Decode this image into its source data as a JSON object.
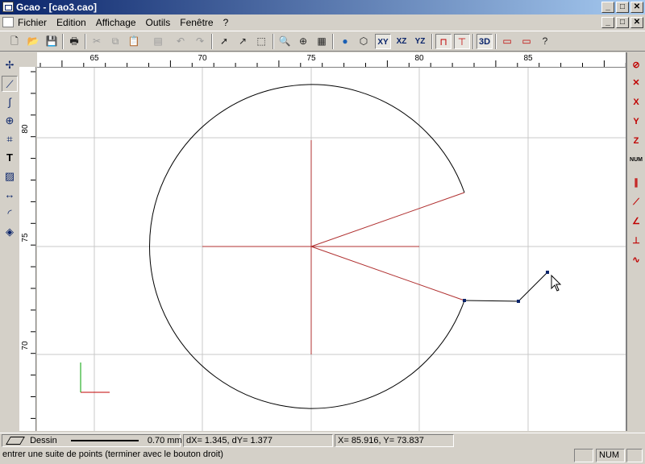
{
  "window": {
    "title": "Gcao - [cao3.cao]"
  },
  "menu": {
    "items": [
      "Fichier",
      "Edition",
      "Affichage",
      "Outils",
      "Fenêtre",
      "?"
    ]
  },
  "toolbar": {
    "label_3d": "3D",
    "label_xy": "XY",
    "label_xz": "XZ",
    "label_yz": "YZ"
  },
  "left_tools": {
    "text_tool": "T"
  },
  "right_tools": {
    "x_label": "X",
    "y_label": "Y",
    "z_label": "Z",
    "num_label": "NUM"
  },
  "ruler": {
    "top_labels": [
      "65",
      "70",
      "75",
      "80",
      "85"
    ],
    "left_labels": [
      "80",
      "75",
      "70"
    ]
  },
  "status": {
    "layer": "Dessin",
    "line_width": "0.70 mm",
    "delta": "dX=     1.345, dY=     1.377",
    "coords": "X=    85.916, Y=    73.837",
    "hint": "entrer une suite de points (terminer avec le bouton droit)",
    "num": "NUM"
  },
  "colors": {
    "accent": "#0a246a",
    "axis": "#b03030",
    "geometry": "#000000"
  }
}
